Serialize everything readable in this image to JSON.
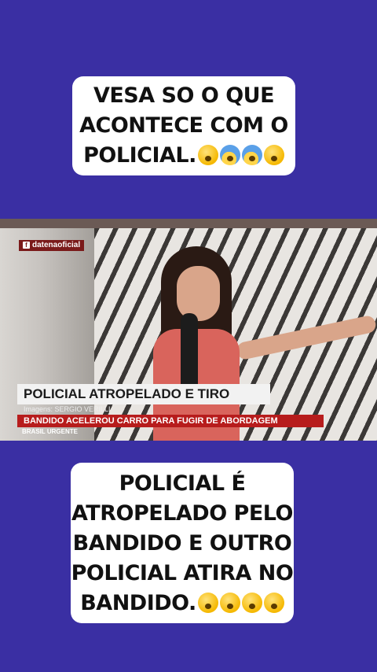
{
  "top_caption": {
    "line1": "VESA SO O QUE",
    "line2": "ACONTECE COM O",
    "line3": "POLICIAL."
  },
  "video": {
    "brand": "datenaoficial",
    "headline": "POLICIAL ATROPELADO E TIRO",
    "credit": "Imagens: SERGIO VERILLI",
    "subheadline": "BANDIDO ACELEROU CARRO PARA FUGIR DE ABORDAGEM",
    "program": "BRASIL URGENTE"
  },
  "bottom_caption": {
    "line1": "POLICIAL É",
    "line2": "ATROPELADO PELO",
    "line3": "BANDIDO E OUTRO",
    "line4": "POLICIAL ATIRA NO",
    "line5": "BANDIDO."
  },
  "colors": {
    "background": "#3a2fa3",
    "caption_bg": "#ffffff",
    "subhead_red": "#b71c1c"
  },
  "icons": {
    "top_emojis": [
      "eye-roll-emoji-icon",
      "screaming-emoji-icon",
      "screaming-emoji-icon",
      "pensive-emoji-icon"
    ],
    "bottom_emojis": [
      "astonished-emoji-icon",
      "astonished-emoji-icon",
      "astonished-emoji-icon",
      "astonished-emoji-icon"
    ]
  }
}
